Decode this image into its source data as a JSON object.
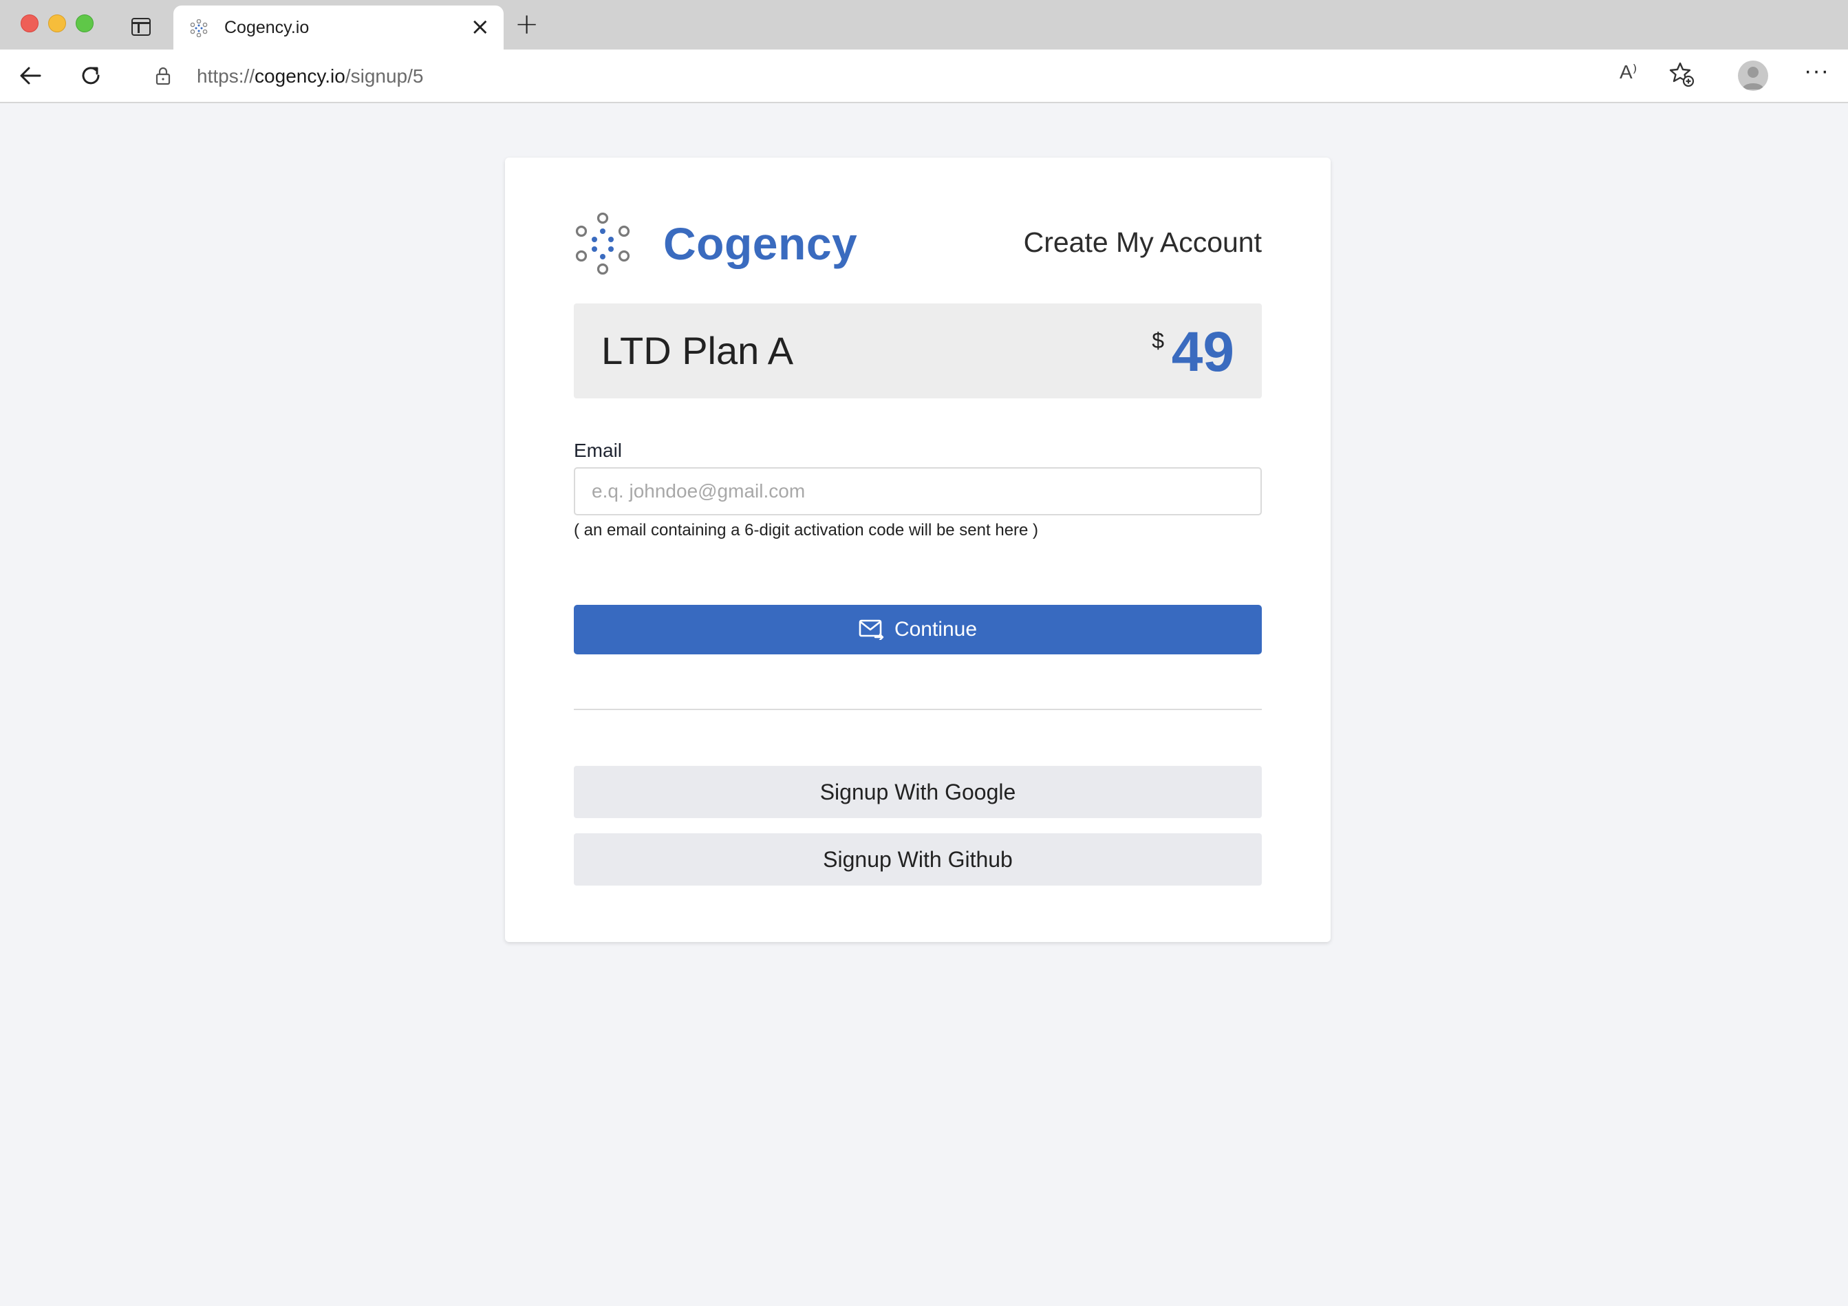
{
  "browser": {
    "tab_title": "Cogency.io",
    "url_scheme": "https://",
    "url_host": "cogency.io",
    "url_path": "/signup/5",
    "read_aloud_label": "A⁾"
  },
  "brand": {
    "name": "Cogency",
    "accent_color": "#3a6bbf"
  },
  "page": {
    "heading": "Create My Account",
    "plan_name": "LTD Plan A",
    "price_currency": "$",
    "price_amount": "49",
    "email_label": "Email",
    "email_placeholder": "e.q. johndoe@gmail.com",
    "email_value": "",
    "email_hint": "( an email containing a 6-digit activation code will be sent here )",
    "continue_label": "Continue",
    "google_label": "Signup With Google",
    "github_label": "Signup With Github"
  },
  "icons": {
    "back": "arrow-left-icon",
    "reload": "reload-icon",
    "lock": "lock-icon",
    "favorites": "star-add-icon",
    "profile": "profile-icon",
    "more": "more-icon",
    "mail": "mail-icon"
  }
}
